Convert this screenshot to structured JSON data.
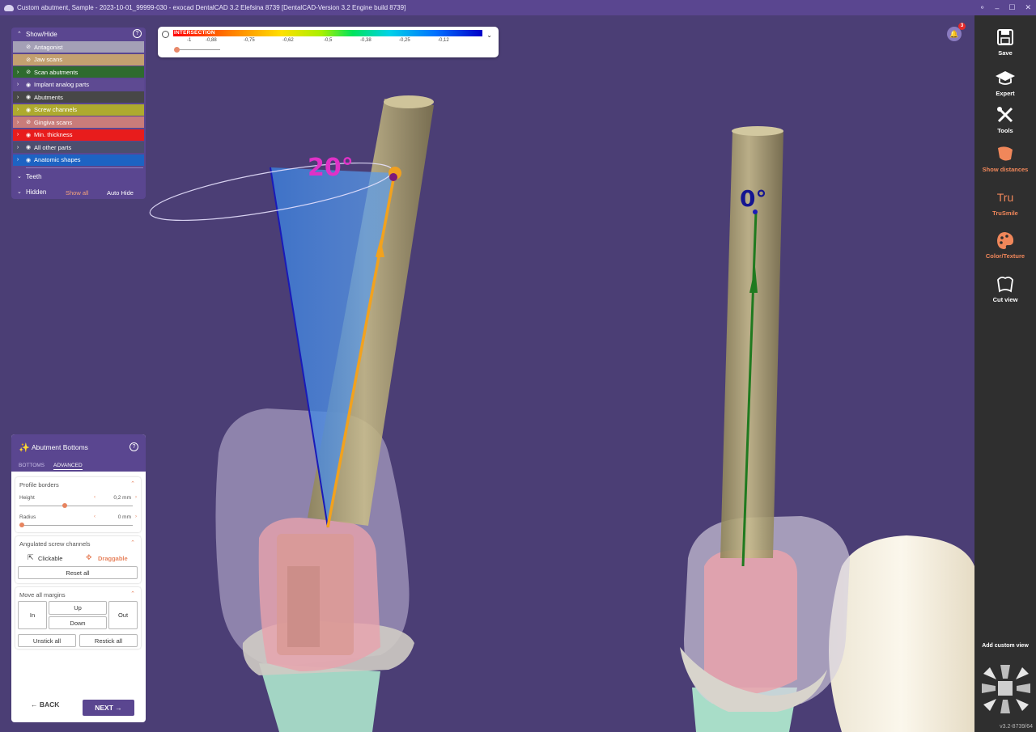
{
  "window": {
    "title": "Custom abutment, Sample - 2023-10-01_99999-030 - exocad DentalCAD 3.2 Elefsina 8739 [DentalCAD-Version 3.2 Engine build 8739]",
    "controls": [
      "⚬",
      "–",
      "☐",
      "✕"
    ]
  },
  "color_scale": {
    "label": "INTERSECTION",
    "ticks": [
      "-1",
      "-0,88",
      "-0,75",
      "-0,62",
      "-0,5",
      "-0,38",
      "-0,25",
      "-0,12"
    ],
    "colors": [
      "#ff0000",
      "#ff7a00",
      "#ffe000",
      "#a8f000",
      "#00e35c",
      "#00d2e8",
      "#0070ff",
      "#0000c8"
    ],
    "slider_level": 0
  },
  "notifications": {
    "count": "3"
  },
  "show_hide": {
    "title": "Show/Hide",
    "layers": [
      {
        "label": "Antagonist",
        "color": "#a4a0b6",
        "expandable": false,
        "visible": false
      },
      {
        "label": "Jaw scans",
        "color": "#c3a070",
        "expandable": false,
        "visible": false
      },
      {
        "label": "Scan abutments",
        "color": "#2e6b2e",
        "expandable": true,
        "visible": false
      },
      {
        "label": "Implant analog parts",
        "color": "#5e4a92",
        "expandable": true,
        "visible": true
      },
      {
        "label": "Abutments",
        "color": "#474747",
        "expandable": true,
        "visible": true
      },
      {
        "label": "Screw channels",
        "color": "#aeaa2e",
        "expandable": true,
        "visible": true
      },
      {
        "label": "Gingiva scans",
        "color": "#c97c7a",
        "expandable": true,
        "visible": false
      },
      {
        "label": "Min. thickness",
        "color": "#e81c1c",
        "expandable": true,
        "visible": true
      },
      {
        "label": "All other parts",
        "color": "#4c4e6e",
        "expandable": true,
        "visible": true
      },
      {
        "label": "Anatomic shapes",
        "color": "#1d63c3",
        "expandable": true,
        "visible": true
      }
    ],
    "teeth_label": "Teeth",
    "hidden_label": "Hidden",
    "show_all": "Show all",
    "auto_hide": "Auto Hide"
  },
  "abutment_panel": {
    "title": "Abutment Bottoms",
    "tabs": [
      "BOTTOMS",
      "ADVANCED"
    ],
    "active_tab": "ADVANCED",
    "profile_borders": {
      "title": "Profile borders",
      "height_label": "Height",
      "height_value": "0,2 mm",
      "radius_label": "Radius",
      "radius_value": "0 mm"
    },
    "angulated": {
      "title": "Angulated screw channels",
      "clickable": "Clickable",
      "draggable": "Draggable",
      "reset_all": "Reset all"
    },
    "margins": {
      "title": "Move all margins",
      "in": "In",
      "up": "Up",
      "down": "Down",
      "out": "Out",
      "unstick_all": "Unstick all",
      "restick_all": "Restick all"
    },
    "back": "BACK",
    "next": "NEXT"
  },
  "right_toolbar": {
    "items": [
      {
        "label": "Save",
        "icon": "save-icon",
        "accent": false
      },
      {
        "label": "Expert",
        "icon": "graduation-cap-icon",
        "accent": false
      },
      {
        "label": "Tools",
        "icon": "tools-icon",
        "accent": false
      },
      {
        "label": "Show distances",
        "icon": "distances-icon",
        "accent": true
      },
      {
        "label": "TruSmile",
        "icon": "trusmile-icon",
        "accent": true
      },
      {
        "label": "Color/Texture",
        "icon": "palette-icon",
        "accent": true
      },
      {
        "label": "Cut view",
        "icon": "tooth-cut-icon",
        "accent": false
      }
    ],
    "add_custom_view": "Add custom view",
    "version": "v3.2-8739/64",
    "trusmile_mark": "Tru"
  },
  "viewport": {
    "angle_left": "20°",
    "angle_right": "0°"
  }
}
